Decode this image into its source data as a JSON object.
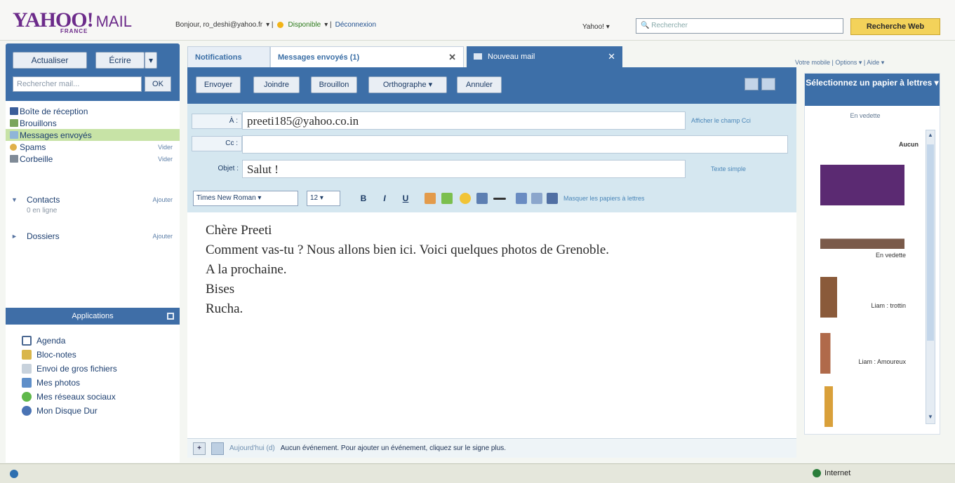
{
  "header": {
    "logo_main": "YAHOO!",
    "logo_mail": "MAIL",
    "logo_sub": "FRANCE",
    "greeting": "Bonjour, ro_deshi@yahoo.fr",
    "status": "Disponible",
    "logout": "Déconnexion",
    "yahoo_menu": "Yahoo! ▾",
    "search_web_placeholder": "Rechercher",
    "search_web_button": "Recherche Web"
  },
  "sidebar": {
    "refresh": "Actualiser",
    "write": "Écrire",
    "write_arrow": "▾",
    "search_placeholder": "Rechercher mail...",
    "search_ok": "OK",
    "folders": [
      {
        "label": "Boîte de réception",
        "action": ""
      },
      {
        "label": "Brouillons",
        "action": ""
      },
      {
        "label": "Messages envoyés",
        "action": ""
      },
      {
        "label": "Spams",
        "action": "Vider"
      },
      {
        "label": "Corbeille",
        "action": "Vider"
      }
    ],
    "contacts": {
      "label": "Contacts",
      "action": "Ajouter",
      "sub": "0 en ligne"
    },
    "dossiers": {
      "label": "Dossiers",
      "action": "Ajouter"
    },
    "apps_header": "Applications",
    "apps": [
      "Agenda",
      "Bloc-notes",
      "Envoi de gros fichiers",
      "Mes photos",
      "Mes réseaux sociaux",
      "Mon Disque Dur"
    ]
  },
  "tabs": {
    "notifications": "Notifications",
    "sent": "Messages envoyés (1)",
    "new_mail": "Nouveau mail",
    "close": "✕"
  },
  "toolbar": {
    "send": "Envoyer",
    "attach": "Joindre",
    "draft": "Brouillon",
    "spelling": "Orthographe ▾",
    "cancel": "Annuler"
  },
  "compose": {
    "to_label": "À :",
    "to_value": "preeti185@yahoo.co.in",
    "show_cci": "Afficher le champ Cci",
    "cc_label": "Cc :",
    "cc_value": "",
    "subject_label": "Objet :",
    "subject_value": "Salut !",
    "plain_text": "Texte simple",
    "font": "Times New Roman",
    "size": "12",
    "bold": "B",
    "italic": "I",
    "underline": "U",
    "hide_stationery": "Masquer les papiers à lettres"
  },
  "message": {
    "lines": [
      "Chère  Preeti",
      "Comment  vas-tu ?  Nous  allons  bien  ici.  Voici  quelques  photos  de  Grenoble.",
      "A  la  prochaine.",
      "Bises",
      "Rucha."
    ]
  },
  "footer": {
    "plus": "+",
    "today": "Aujourd'hui (d)",
    "info": "Aucun événement. Pour ajouter un événement, cliquez sur le signe plus."
  },
  "right": {
    "links": "Votre mobile | Options ▾ | Aide ▾",
    "header": "Sélectionnez un papier à lettres ▾",
    "featured": "En vedette",
    "none": "Aucun",
    "thumbs": [
      "",
      "En vedette",
      "Liam : trottin",
      "Liam : Amoureux",
      ""
    ]
  },
  "statusbar": {
    "zone": "Internet"
  },
  "colors": {
    "brand": "#6c2b8a",
    "accent": "#3d6fa8",
    "selected_folder": "#c7e3a6",
    "search_button": "#f3d25a"
  }
}
